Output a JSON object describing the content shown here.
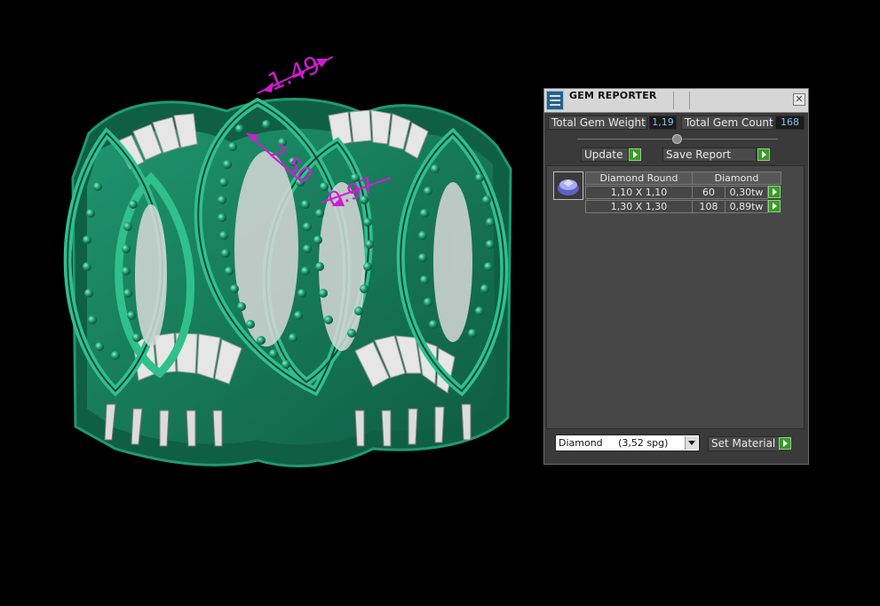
{
  "viewport": {
    "dimensions": [
      "1.49",
      "2.50",
      "0.97"
    ],
    "colors": {
      "model": "#1e8a65",
      "dimension": "#d21ad2",
      "background": "#000000"
    }
  },
  "panel": {
    "title": "GEM REPORTER",
    "close_glyph": "✕",
    "total_weight_label": "Total Gem Weight",
    "total_weight_value": "1,19",
    "total_count_label": "Total Gem Count",
    "total_count_value": "168",
    "update_label": "Update",
    "save_report_label": "Save Report",
    "table": {
      "headers": [
        "Diamond Round",
        "Diamond"
      ],
      "rows": [
        {
          "size": "1,10 X 1,10",
          "count": "60",
          "weight": "0,30tw"
        },
        {
          "size": "1,30 X 1,30",
          "count": "108",
          "weight": "0,89tw"
        }
      ]
    },
    "material_select": "Diamond     (3,52 spg)",
    "set_material_label": "Set Material",
    "icons": [
      "app-icon",
      "close-icon",
      "slider-knob",
      "play-icon",
      "dropdown-arrow-icon",
      "gem-thumbnail"
    ]
  }
}
